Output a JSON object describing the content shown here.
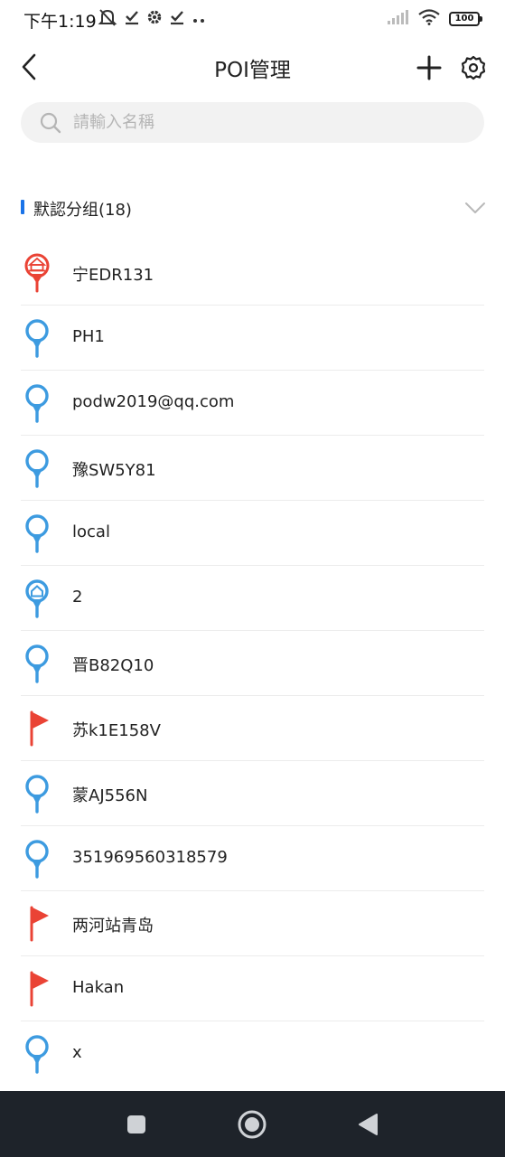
{
  "status_bar": {
    "time": "下午1:19",
    "battery": "100"
  },
  "header": {
    "title": "POI管理",
    "back_icon": "chevron-left-icon",
    "add_icon": "plus-icon",
    "settings_icon": "gear-icon"
  },
  "search": {
    "placeholder": "請輸入名稱",
    "value": ""
  },
  "group": {
    "title": "默認分组(18)",
    "accent_color": "#1a73e8"
  },
  "poi_items": [
    {
      "label": "宁EDR131",
      "icon": "red-building-pin-icon"
    },
    {
      "label": "PH1",
      "icon": "blue-pin-icon"
    },
    {
      "label": "podw2019@qq.com",
      "icon": "blue-pin-icon"
    },
    {
      "label": "豫SW5Y81",
      "icon": "blue-pin-icon"
    },
    {
      "label": "local",
      "icon": "blue-pin-icon"
    },
    {
      "label": "2",
      "icon": "blue-home-pin-icon"
    },
    {
      "label": "晋B82Q10",
      "icon": "blue-pin-icon"
    },
    {
      "label": "苏k1E158V",
      "icon": "red-flag-icon"
    },
    {
      "label": "蒙AJ556N",
      "icon": "blue-pin-icon"
    },
    {
      "label": "351969560318579",
      "icon": "blue-pin-icon"
    },
    {
      "label": "两河站青岛",
      "icon": "red-flag-icon"
    },
    {
      "label": "Hakan",
      "icon": "red-flag-icon"
    },
    {
      "label": "x",
      "icon": "blue-pin-icon"
    }
  ],
  "colors": {
    "pin_blue": "#3d9be0",
    "flag_red": "#ea4335",
    "nav_bar": "#1e232a"
  }
}
